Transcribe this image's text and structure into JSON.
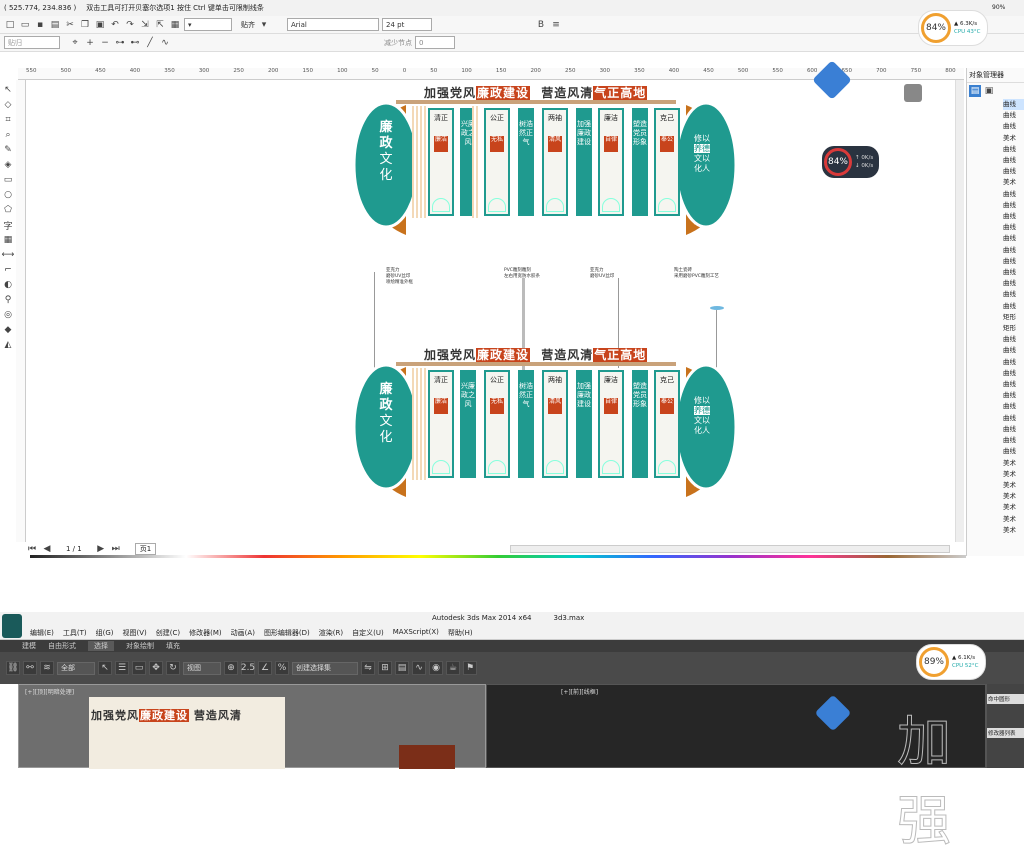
{
  "coreldraw": {
    "status_coords": "( 525.774, 234.836 )",
    "status_hint": "双击工具可打开贝塞尔选项1 按住 Ctrl 键单击可限制线条",
    "snap_label": "贴齐",
    "font_name": "Arial",
    "font_size": "24 pt",
    "reduce_nodes": "减少节点",
    "reduce_value": "0",
    "preset_value": "贴归",
    "ruler_ticks": [
      "550",
      "500",
      "450",
      "400",
      "350",
      "300",
      "250",
      "200",
      "150",
      "100",
      "50",
      "0",
      "50",
      "100",
      "150",
      "200",
      "250",
      "300",
      "350",
      "400",
      "450",
      "500",
      "550",
      "600",
      "650",
      "700",
      "750",
      "800"
    ],
    "page_nav": "1 / 1",
    "page_tab": "页1",
    "docker_title": "对象管理器",
    "docker_items": [
      "曲线",
      "曲线",
      "曲线",
      "美术",
      "曲线",
      "曲线",
      "曲线",
      "美术",
      "曲线",
      "曲线",
      "曲线",
      "曲线",
      "曲线",
      "曲线",
      "曲线",
      "曲线",
      "曲线",
      "曲线",
      "曲线",
      "矩形",
      "矩形",
      "曲线",
      "曲线",
      "曲线",
      "曲线",
      "曲线",
      "曲线",
      "曲线",
      "曲线",
      "曲线",
      "曲线",
      "曲线",
      "美术",
      "美术",
      "美术",
      "美术",
      "美术",
      "美术",
      "美术"
    ],
    "hud": {
      "percent": "84%",
      "speed_up": "6.3K/s",
      "cpu": "CPU 43°C",
      "battery": "90%"
    },
    "hud_small": {
      "percent": "84%",
      "up": "0K/s",
      "down": "0K/s"
    }
  },
  "design": {
    "title_a": "加强党风",
    "title_hl1": "廉政建设",
    "title_b": "营造风清",
    "title_hl2": "气正高地",
    "left_circle": [
      "廉",
      "政",
      "文",
      "化"
    ],
    "right_text": [
      "修",
      "以",
      "养",
      "德",
      "文",
      "以",
      "化",
      "人"
    ],
    "panels": [
      {
        "head": "清正",
        "red": "廉洁"
      },
      {
        "head": "公正",
        "red": "无私"
      },
      {
        "head": "两袖",
        "red": "清风"
      },
      {
        "head": "廉洁",
        "red": "自律"
      },
      {
        "head": "克己",
        "red": "奉公"
      }
    ],
    "strips": [
      "兴廉政之风",
      "树浩然正气",
      "加强廉政建设",
      "塑造党员形象"
    ],
    "notes": [
      "亚克力\n磨砂UV丝印\n喷绘精准外框",
      "PVC雕刻雕刻\n左右用宽防水胶条",
      "亚克力\n磨砂UV丝印",
      "陶土瓷砖\n采用磨砂PVC雕刻工艺"
    ]
  },
  "max": {
    "window_title": "Autodesk 3ds Max  2014 x64",
    "file_name": "3d3.max",
    "menu": [
      "编辑(E)",
      "工具(T)",
      "组(G)",
      "视图(V)",
      "创建(C)",
      "修改器(M)",
      "动画(A)",
      "图形编辑器(D)",
      "渲染(R)",
      "自定义(U)",
      "MAXScript(X)",
      "帮助(H)"
    ],
    "ribbon_tabs": [
      "建模",
      "自由形式",
      "选择",
      "对象绘制",
      "填充"
    ],
    "filter_all": "全部",
    "view_dropdown": "视图",
    "selection_set": "创建选择集",
    "viewport_left": "[+][顶][明暗处理]",
    "viewport_right": "[+][前][线框]",
    "right_panel_top": "命中圆形",
    "right_panel_bottom": "修改器列表",
    "hud": {
      "percent": "89%",
      "up": "6.1K/s",
      "cpu": "CPU 52°C"
    },
    "big_glyphs": "加强"
  }
}
